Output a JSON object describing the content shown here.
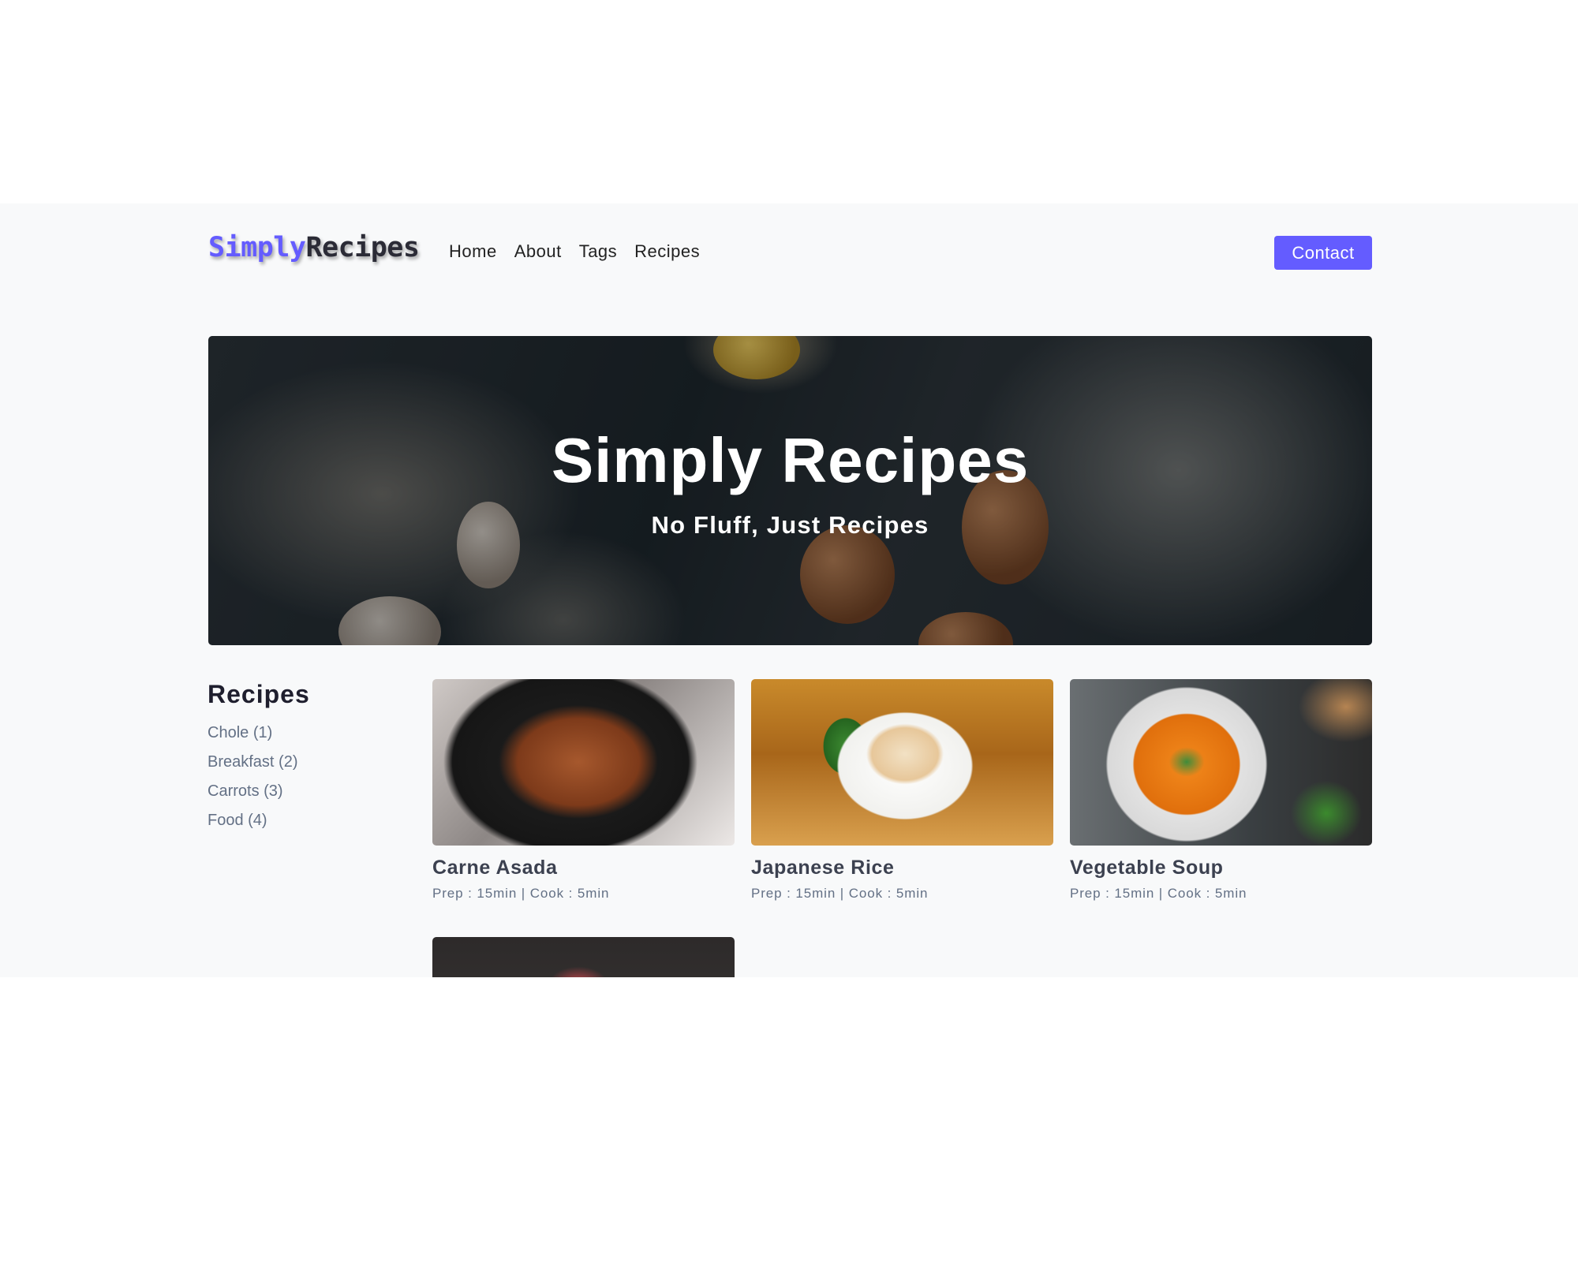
{
  "brand": {
    "part1": "Simply",
    "part2": "Recipes",
    "accent_color": "#645cff"
  },
  "nav": {
    "links": [
      "Home",
      "About",
      "Tags",
      "Recipes"
    ],
    "contact_label": "Contact"
  },
  "hero": {
    "title": "Simply Recipes",
    "subtitle": "No Fluff, Just Recipes"
  },
  "tags": {
    "title": "Recipes",
    "items": [
      "Chole (1)",
      "Breakfast (2)",
      "Carrots (3)",
      "Food (4)"
    ]
  },
  "recipes": [
    {
      "name": "Carne Asada",
      "meta": "Prep : 15min | Cook : 5min"
    },
    {
      "name": "Japanese Rice",
      "meta": "Prep : 15min | Cook : 5min"
    },
    {
      "name": "Vegetable Soup",
      "meta": "Prep : 15min | Cook : 5min"
    }
  ]
}
